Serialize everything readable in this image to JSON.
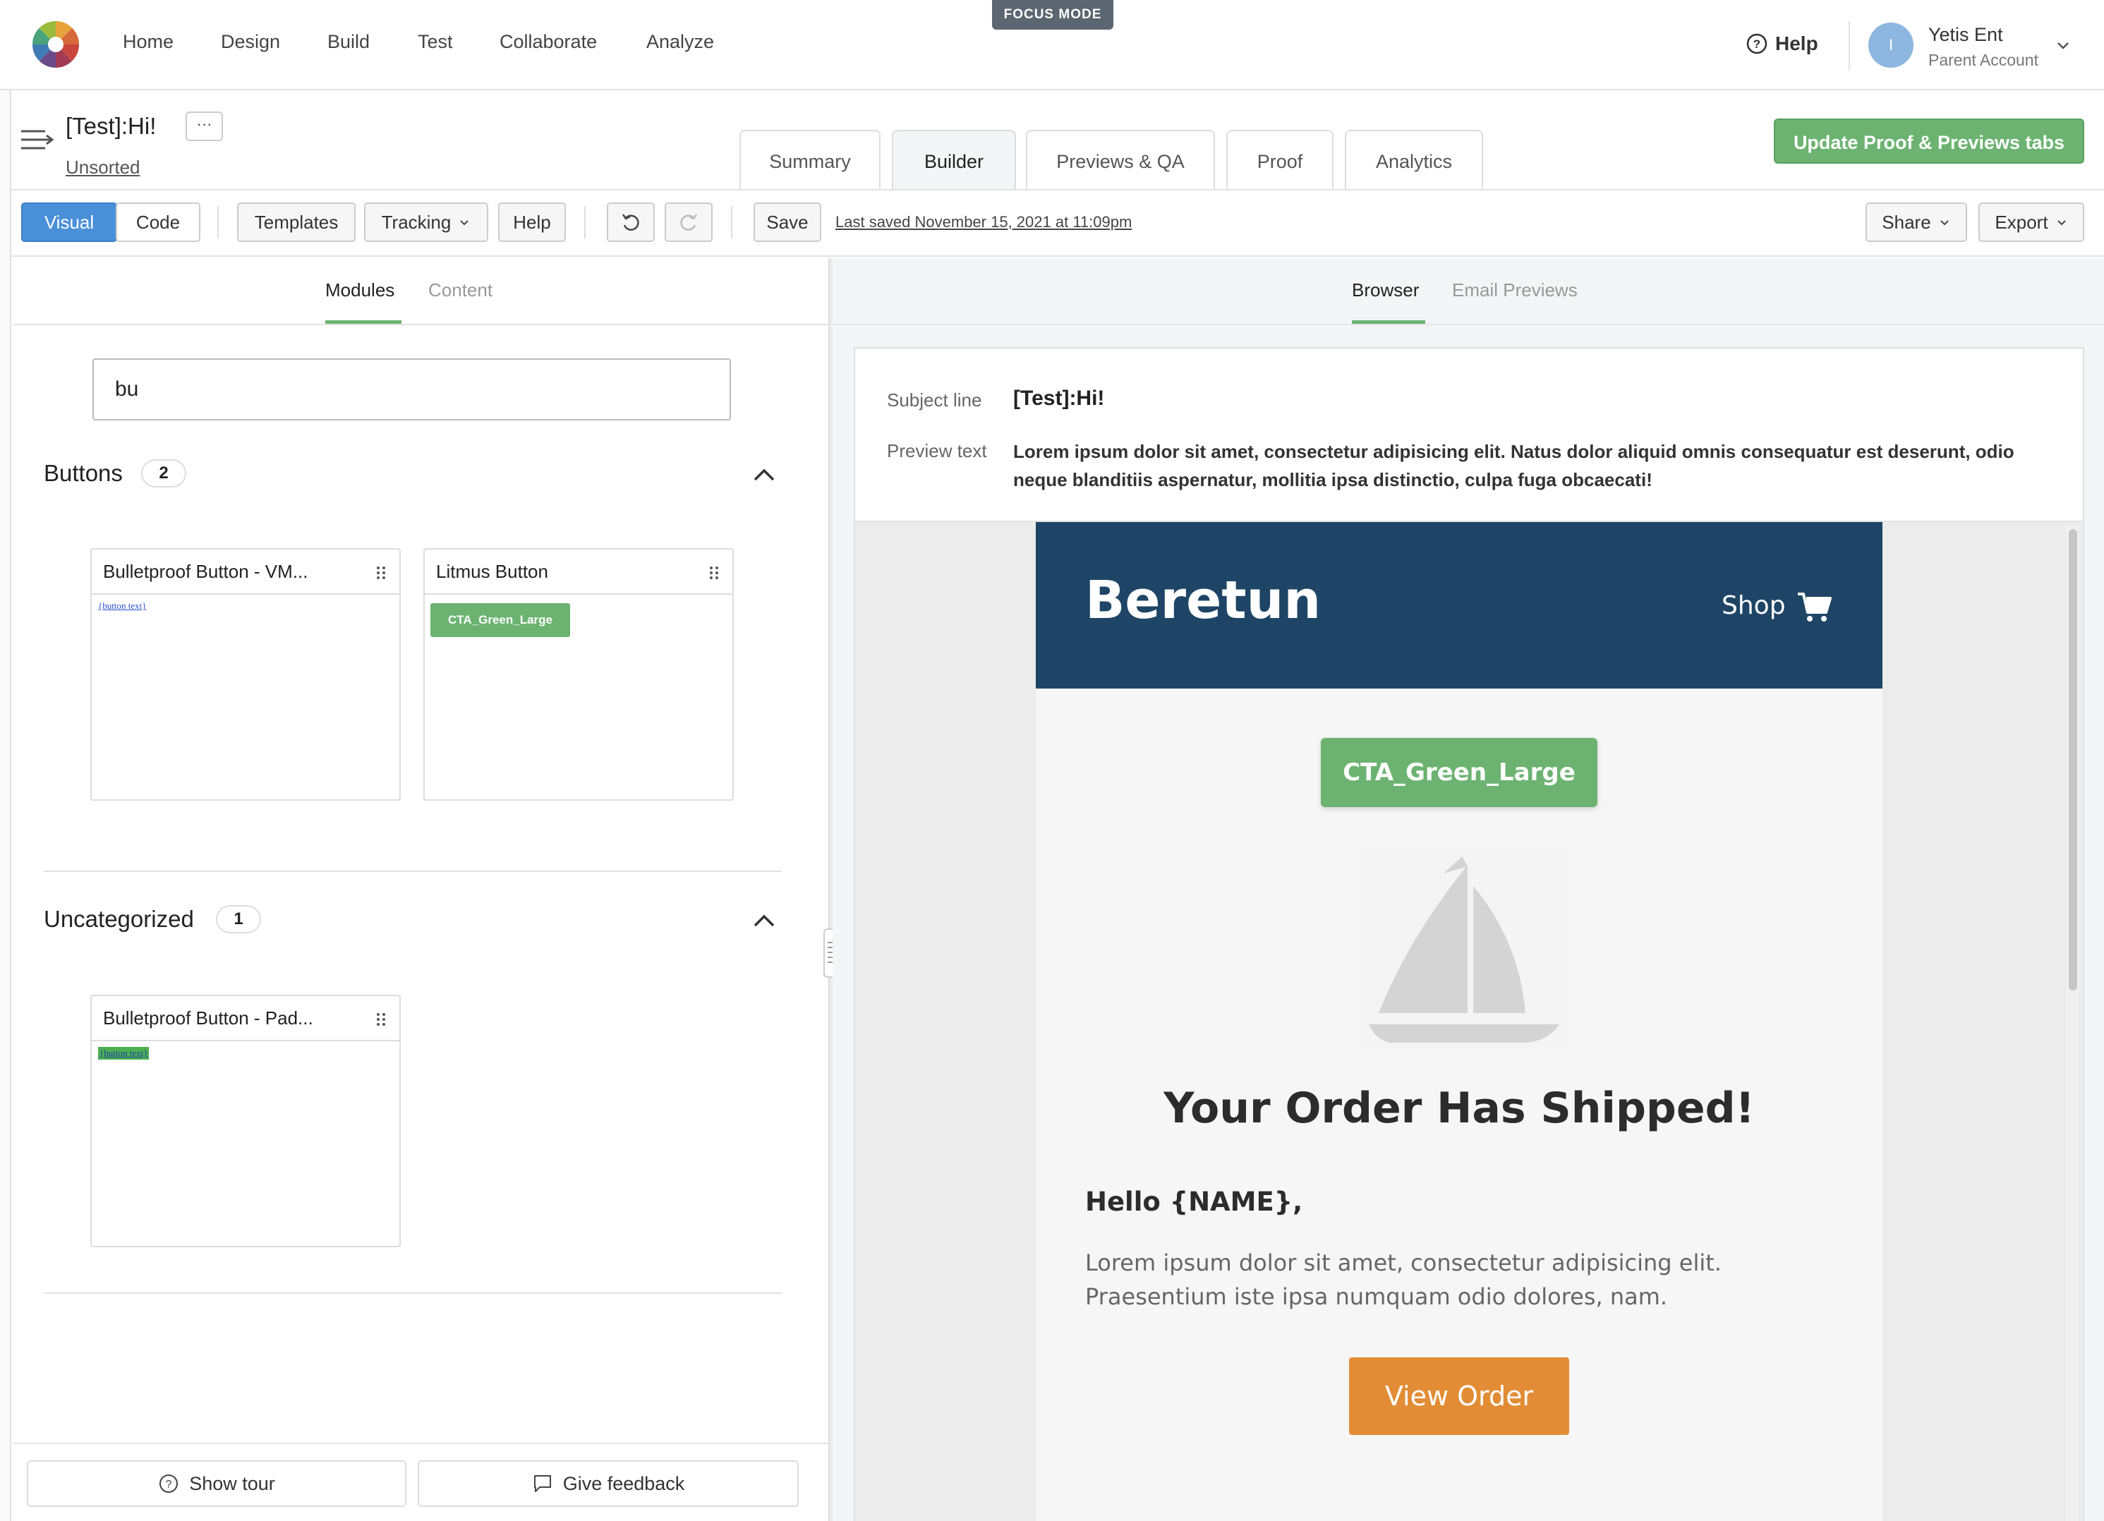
{
  "topnav": {
    "items": [
      "Home",
      "Design",
      "Build",
      "Test",
      "Collaborate",
      "Analyze"
    ],
    "focus_mode": "FOCUS MODE",
    "help": "Help",
    "account": {
      "initial": "I",
      "name": "Yetis Ent",
      "sub": "Parent Account"
    }
  },
  "doc": {
    "title": "[Test]:Hi!",
    "more": "···",
    "folder": "Unsorted"
  },
  "tabs": [
    "Summary",
    "Builder",
    "Previews & QA",
    "Proof",
    "Analytics"
  ],
  "active_tab": "Builder",
  "update_button": "Update Proof & Previews tabs",
  "toolbar": {
    "visual": "Visual",
    "code": "Code",
    "templates": "Templates",
    "tracking": "Tracking",
    "help": "Help",
    "save": "Save",
    "last_saved": "Last saved November 15, 2021 at 11:09pm",
    "share": "Share",
    "export": "Export"
  },
  "left_panel": {
    "subtabs": [
      "Modules",
      "Content"
    ],
    "search_value": "bu",
    "categories": [
      {
        "title": "Buttons",
        "count": "2",
        "cards": [
          {
            "title": "Bulletproof Button - VM...",
            "preview_text": "{button text}"
          },
          {
            "title": "Litmus Button",
            "preview_text": "CTA_Green_Large"
          }
        ]
      },
      {
        "title": "Uncategorized",
        "count": "1",
        "cards": [
          {
            "title": "Bulletproof Button - Pad...",
            "preview_text": "{button text}"
          }
        ]
      }
    ],
    "footer": {
      "tour": "Show tour",
      "feedback": "Give feedback"
    }
  },
  "right_panel": {
    "subtabs": [
      "Browser",
      "Email Previews"
    ],
    "subject_label": "Subject line",
    "subject": "[Test]:Hi!",
    "preview_label": "Preview text",
    "preview_text": "Lorem ipsum dolor sit amet, consectetur adipisicing elit. Natus dolor aliquid omnis consequatur est deserunt, odio neque blanditiis aspernatur, mollitia ipsa distinctio, culpa fuga obcaecati!"
  },
  "email": {
    "brand": "Beretun",
    "shop": "Shop",
    "cta": "CTA_Green_Large",
    "headline": "Your Order Has Shipped!",
    "greeting": "Hello {NAME},",
    "body": "Lorem ipsum dolor sit amet, consectetur adipisicing elit. Praesentium iste ipsa numquam odio dolores, nam.",
    "button": "View Order"
  },
  "colors": {
    "accent_green": "#6cb371",
    "email_header": "#1e4566",
    "view_order": "#e28d36",
    "visual_active": "#4a90d9"
  }
}
